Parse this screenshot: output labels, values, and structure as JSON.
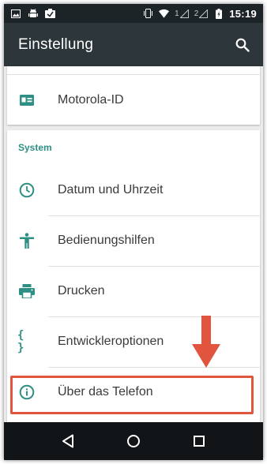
{
  "status_bar": {
    "icons_left": [
      "image-icon",
      "android-debug-icon",
      "sync-notification-icon"
    ],
    "sim1": "1",
    "sim2": "2",
    "time": "15:19"
  },
  "app_bar": {
    "title": "Einstellung",
    "search_icon": "search-icon"
  },
  "top_card": {
    "items": [
      {
        "icon": "id-card-icon",
        "label": "Motorola-ID"
      }
    ]
  },
  "system_section": {
    "header": "System",
    "items": [
      {
        "icon": "clock-icon",
        "label": "Datum und Uhrzeit"
      },
      {
        "icon": "accessibility-icon",
        "label": "Bedienungshilfen"
      },
      {
        "icon": "printer-icon",
        "label": "Drucken"
      },
      {
        "icon": "curly-braces-icon",
        "label": "Entwickleroptionen",
        "glyph": "{ }"
      },
      {
        "icon": "info-icon",
        "label": "Über das Telefon"
      }
    ]
  },
  "annotation": {
    "highlight_color": "#e1543d",
    "arrow_color": "#e1543d",
    "highlighted_item": "Über das Telefon"
  },
  "nav_bar": {
    "buttons": [
      "back-icon",
      "home-icon",
      "recents-icon"
    ]
  },
  "colors": {
    "accent": "#2e8f84",
    "app_bar": "#2d363a",
    "status_bar": "#1d2428",
    "nav_bar": "#111517"
  }
}
